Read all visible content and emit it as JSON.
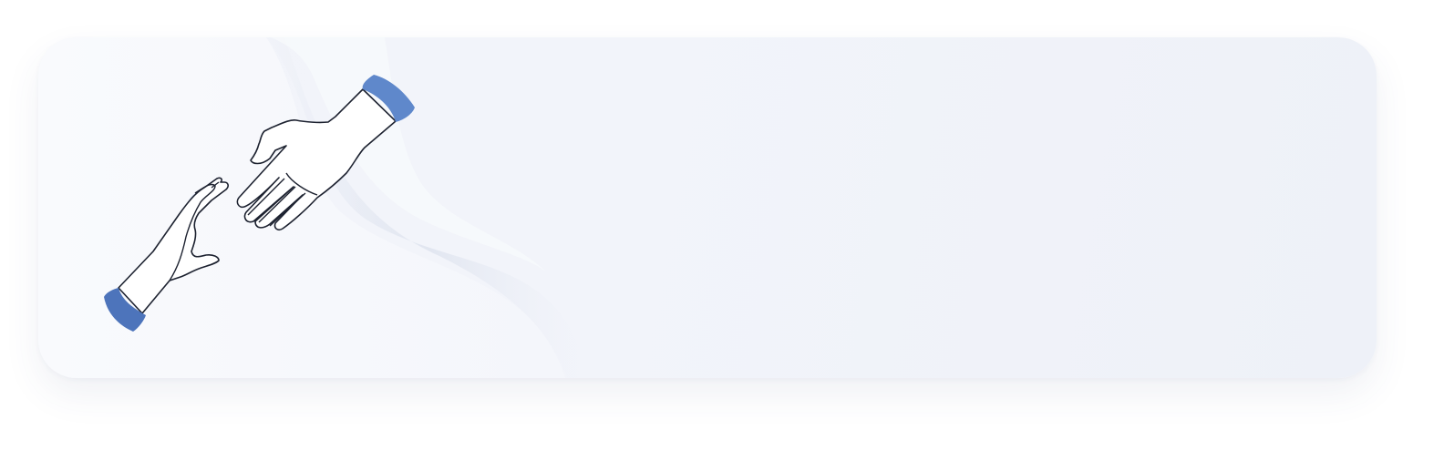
{
  "banner": {
    "illustration": "reaching-hands",
    "colors": {
      "background": "#f1f3f9",
      "wave_light": "#f8f9fc",
      "wave_shadow": "#dfe4ef",
      "cuff_blue": "#5b84c8",
      "cuff_blue_dark": "#4a72b8",
      "outline": "#1d2230",
      "skin": "#ffffff",
      "skin_shadow": "#c9d5e8"
    }
  }
}
